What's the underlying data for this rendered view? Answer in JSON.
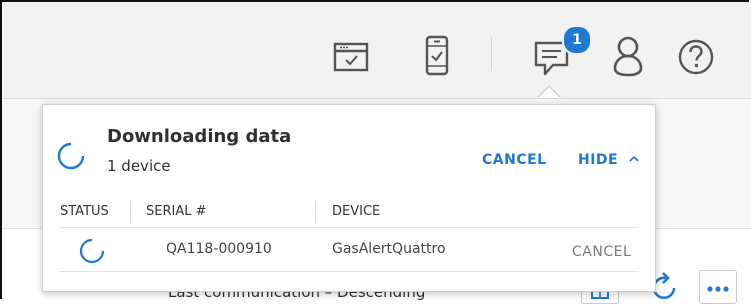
{
  "header": {
    "icons": [
      "window-check-icon",
      "device-check-icon",
      "chat-message-icon",
      "user-icon",
      "help-icon"
    ],
    "notification_count": "1",
    "accent": "#1e78d4"
  },
  "download_panel": {
    "title": "Downloading data",
    "subtitle": "1 device",
    "cancel_label": "CANCEL",
    "hide_label": "HIDE",
    "hide_icon": "chevron-up-icon",
    "columns": [
      "STATUS",
      "SERIAL #",
      "DEVICE"
    ],
    "rows": [
      {
        "status_icon": "spinner-icon",
        "serial": "QA118-000910",
        "device": "GasAlertQuattro",
        "action": "CANCEL"
      }
    ]
  }
}
